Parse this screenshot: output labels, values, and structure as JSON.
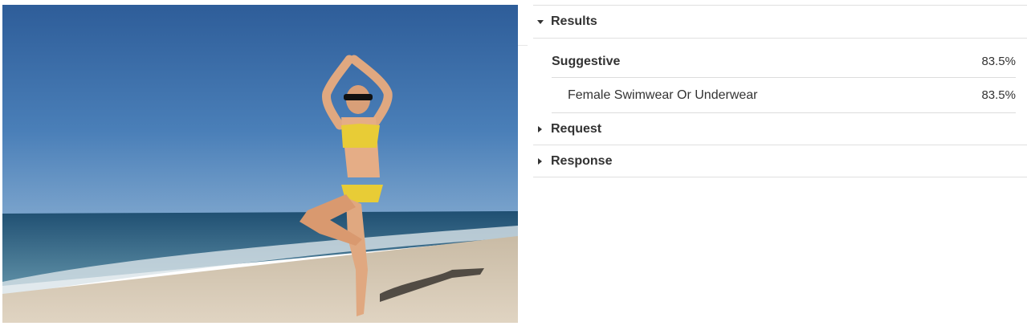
{
  "image": {
    "alt_icon": "beach-yoga-photo"
  },
  "results": {
    "header": "Results",
    "category": {
      "label": "Suggestive",
      "value": "83.5%"
    },
    "subcategory": {
      "label": "Female Swimwear Or Underwear",
      "value": "83.5%"
    }
  },
  "request": {
    "header": "Request"
  },
  "response": {
    "header": "Response"
  },
  "colors": {
    "text": "#333333",
    "divider": "#e0e0e0",
    "sky": "#3f73ad",
    "sea": "#2a5f86",
    "sand": "#d9cbb6"
  }
}
